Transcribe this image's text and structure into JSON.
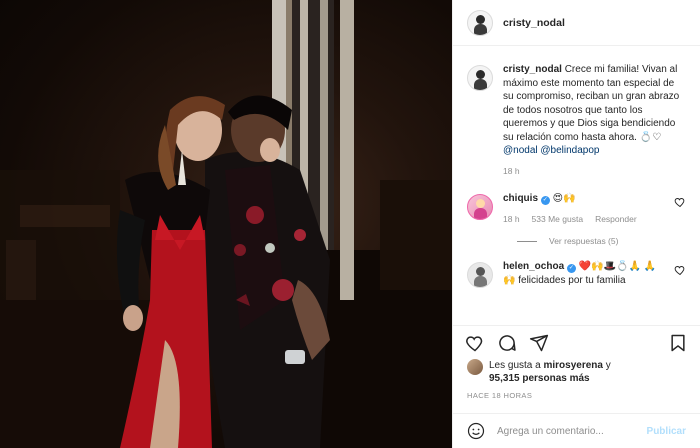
{
  "post": {
    "username": "cristy_nodal",
    "caption": {
      "username": "cristy_nodal",
      "text": "Crece mi familia! Vivan al máximo este momento tan especial de su compromiso, reciban un gran abrazo de todos nosotros que tanto los queremos y que Dios siga bendiciendo su relación como hasta ahora. 💍♡",
      "mention_1": "@nodal",
      "mention_2": "@belindapop",
      "time": "18 h"
    },
    "comments": [
      {
        "username": "chiquis",
        "text": "😍🙌",
        "time": "18 h",
        "likes": "533 Me gusta",
        "reply_label": "Responder",
        "view_replies": "Ver respuestas (5)"
      },
      {
        "username": "helen_ochoa",
        "text": "❤️🙌🎩💍🙏 🙏🙌 felicidades por tu familia"
      }
    ],
    "likes_line": {
      "prefix": "Les gusta a",
      "user": "mirosyerena",
      "middle": "y",
      "count": "95,315 personas más"
    },
    "timestamp": "HACE 18 HORAS",
    "add_comment": {
      "placeholder": "Agrega un comentario...",
      "post_label": "Publicar"
    }
  },
  "icons": {
    "like": "heart-icon",
    "comment": "comment-icon",
    "share": "paper-plane-icon",
    "save": "bookmark-icon",
    "emoji": "smiley-icon"
  },
  "colors": {
    "link": "#00376b",
    "verified": "#3897f0",
    "muted": "#8e8e8e",
    "post_button": "#b2dffc",
    "dress": "#b3121d"
  }
}
